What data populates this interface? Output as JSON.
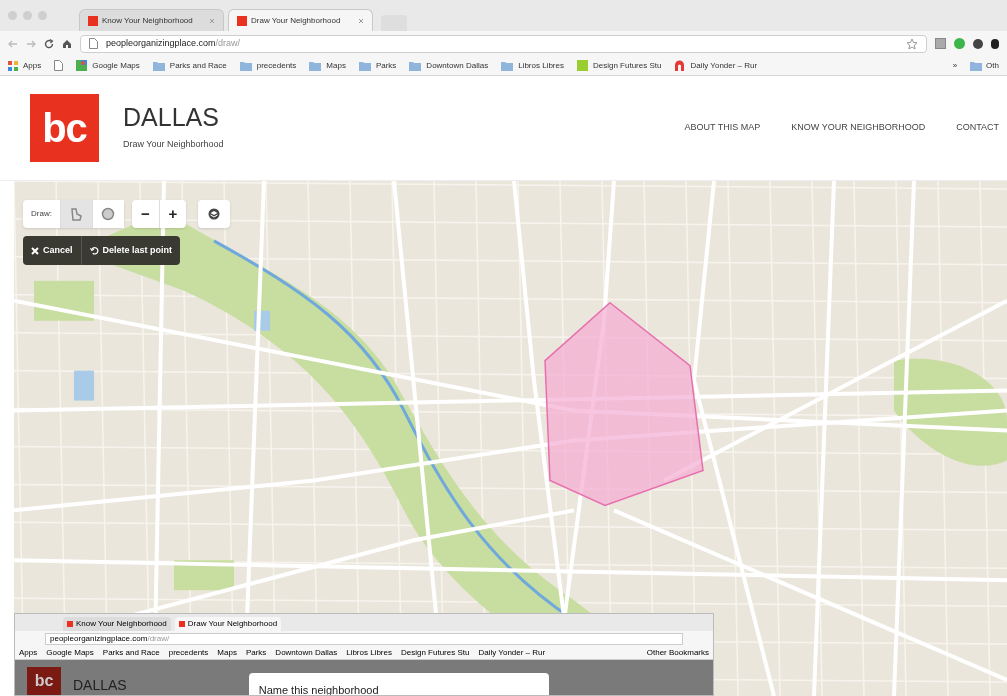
{
  "browser": {
    "tabs": [
      {
        "title": "Know Your Neighborhood",
        "selected": false
      },
      {
        "title": "Draw Your Neighborhood",
        "selected": true
      }
    ],
    "url": {
      "host": "peopleorganizingplace.com",
      "path": "/draw/"
    },
    "bookmarks": [
      {
        "kind": "apps",
        "label": "Apps"
      },
      {
        "kind": "page"
      },
      {
        "kind": "maps",
        "label": "Google Maps"
      },
      {
        "kind": "folder",
        "label": "Parks and Race"
      },
      {
        "kind": "folder",
        "label": "precedents"
      },
      {
        "kind": "folder",
        "label": "Maps"
      },
      {
        "kind": "folder",
        "label": "Parks"
      },
      {
        "kind": "folder",
        "label": "Downtown Dallas"
      },
      {
        "kind": "folder",
        "label": "Libros Libres"
      },
      {
        "kind": "site",
        "label": "Design Futures Stu"
      },
      {
        "kind": "arch",
        "label": "Daily Yonder – Rur"
      }
    ],
    "more": "»",
    "other": "Oth"
  },
  "header": {
    "logo": "bc",
    "title": "DALLAS",
    "subtitle": "Draw Your Neighborhood",
    "nav": [
      "ABOUT THIS MAP",
      "KNOW YOUR NEIGHBORHOOD",
      "CONTACT"
    ]
  },
  "map": {
    "draw_label": "Draw:",
    "tools": [
      {
        "kind": "polygon",
        "selected": true
      },
      {
        "kind": "circle",
        "selected": false
      }
    ],
    "zoom": [
      "−",
      "+"
    ],
    "actions": [
      {
        "kind": "cancel",
        "label": "Cancel"
      },
      {
        "kind": "undo",
        "label": "Delete last point"
      }
    ]
  },
  "inset": {
    "tabs": [
      {
        "title": "Know Your Neighborhood",
        "selected": false
      },
      {
        "title": "Draw Your Neighborhood",
        "selected": true
      }
    ],
    "url": {
      "host": "peopleorganizingplace.com",
      "path": "/draw/"
    },
    "bookmarks": [
      "Apps",
      "Google Maps",
      "Parks and Race",
      "precedents",
      "Maps",
      "Parks",
      "Downtown Dallas",
      "Libros Libres",
      "Design Futures Stu",
      "Daily Yonder – Rur"
    ],
    "other": "Other Bookmarks",
    "logo": "bc",
    "title": "DALLAS",
    "dialog_title": "Name this neighborhood"
  }
}
